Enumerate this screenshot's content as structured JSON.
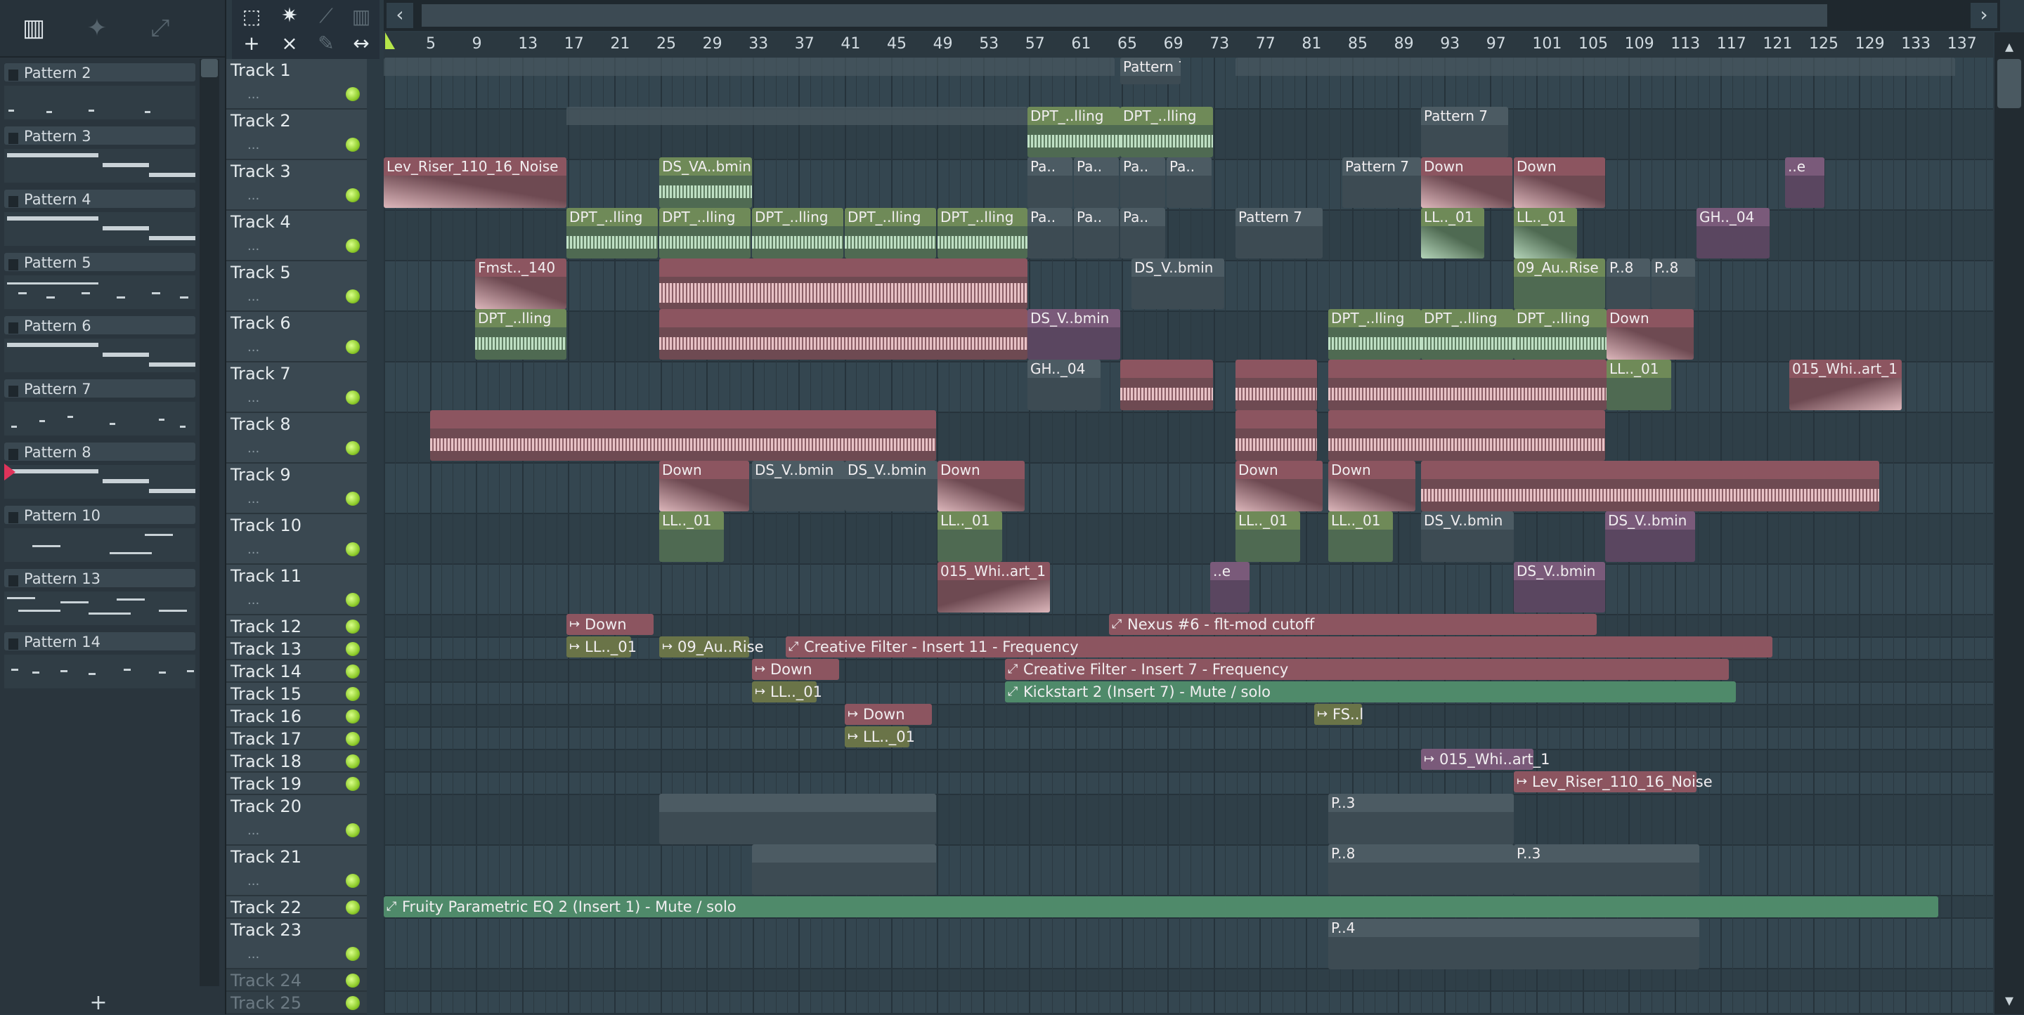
{
  "picker": {
    "patterns": [
      {
        "name": "Pattern 2"
      },
      {
        "name": "Pattern 3"
      },
      {
        "name": "Pattern 4"
      },
      {
        "name": "Pattern 5"
      },
      {
        "name": "Pattern 6"
      },
      {
        "name": "Pattern 7"
      },
      {
        "name": "Pattern 8"
      },
      {
        "name": "Pattern 10"
      },
      {
        "name": "Pattern 13"
      },
      {
        "name": "Pattern 14"
      }
    ],
    "add_label": "+"
  },
  "toolbar": {
    "add_label": "+",
    "close_label": "×"
  },
  "ruler": {
    "bars": [
      "5",
      "9",
      "13",
      "17",
      "21",
      "25",
      "29",
      "33",
      "37",
      "41",
      "45",
      "49",
      "53",
      "57",
      "61",
      "65",
      "69",
      "73",
      "77",
      "81",
      "85",
      "89",
      "93",
      "97",
      "101",
      "105",
      "109",
      "113",
      "117",
      "121",
      "125",
      "129",
      "133",
      "137"
    ]
  },
  "tracks": [
    {
      "name": "Track 1"
    },
    {
      "name": "Track 2"
    },
    {
      "name": "Track 3"
    },
    {
      "name": "Track 4"
    },
    {
      "name": "Track 5"
    },
    {
      "name": "Track 6"
    },
    {
      "name": "Track 7"
    },
    {
      "name": "Track 8"
    },
    {
      "name": "Track 9"
    },
    {
      "name": "Track 10"
    },
    {
      "name": "Track 11"
    },
    {
      "name": "Track 12"
    },
    {
      "name": "Track 13"
    },
    {
      "name": "Track 14"
    },
    {
      "name": "Track 15"
    },
    {
      "name": "Track 16"
    },
    {
      "name": "Track 17"
    },
    {
      "name": "Track 18"
    },
    {
      "name": "Track 19"
    },
    {
      "name": "Track 20"
    },
    {
      "name": "Track 21"
    },
    {
      "name": "Track 22"
    },
    {
      "name": "Track 23"
    },
    {
      "name": "Track 24"
    },
    {
      "name": "Track 25"
    }
  ],
  "track_dots": "...",
  "clips": {
    "t1_pattern7": "Pattern 7",
    "t2_dpt_a": "DPT_..lling",
    "t2_dpt_b": "DPT_..lling",
    "t2_pattern7": "Pattern 7",
    "t3_riser": "Lev_Riser_110_16_Noise",
    "t3_dsva": "DS_VA..bmin",
    "t3_pa1": "Pa..",
    "t3_pa2": "Pa..",
    "t3_pa3": "Pa..",
    "t3_pa4": "Pa..",
    "t3_pattern7": "Pattern 7",
    "t3_down1": "Down",
    "t3_down2": "Down",
    "t3_e": "..e",
    "t4_dpt1": "DPT_..lling",
    "t4_dpt2": "DPT_..lling",
    "t4_dpt3": "DPT_..lling",
    "t4_dpt4": "DPT_..lling",
    "t4_dpt5": "DPT_..lling",
    "t4_pa1": "Pa..",
    "t4_pa2": "Pa..",
    "t4_pa3": "Pa..",
    "t4_pattern7": "Pattern 7",
    "t4_ll1": "LL.._01",
    "t4_ll2": "LL.._01",
    "t4_gh": "GH.._04",
    "t5_fmst": "Fmst.._140",
    "t5_dsv": "DS_V..bmin",
    "t5_09au": "09_Au..Rise",
    "t5_p8a": "P..8",
    "t5_p8b": "P..8",
    "t6_dpt": "DPT_..lling",
    "t6_dsv": "DS_V..bmin",
    "t6_dpt2": "DPT_..lling",
    "t6_dpt3": "DPT_..lling",
    "t6_dpt4": "DPT_..lling",
    "t6_down": "Down",
    "t7_gh": "GH.._04",
    "t7_ll": "LL.._01",
    "t7_015": "015_Whi..art_1",
    "t9_down1": "Down",
    "t9_dsv1": "DS_V..bmin",
    "t9_dsv2": "DS_V..bmin",
    "t9_down2": "Down",
    "t9_down3": "Down",
    "t9_down4": "Down",
    "t10_ll1": "LL.._01",
    "t10_ll2": "LL.._01",
    "t10_ll3": "LL.._01",
    "t10_ll4": "LL.._01",
    "t10_dsv1": "DS_V..bmin",
    "t10_dsv2": "DS_V..bmin",
    "t11_015": "015_Whi..art_1",
    "t11_e": "..e",
    "t11_dsv": "DS_V..bmin",
    "t12_down": "Down",
    "t12_nexus": "Nexus #6 - flt-mod cutoff",
    "t13_ll": "LL.._01",
    "t13_09au": "09_Au..Rise",
    "t13_filter": "Creative Filter - Insert 11 - Frequency",
    "t14_down": "Down",
    "t14_filter": "Creative Filter - Insert 7 - Frequency",
    "t15_ll": "LL.._01",
    "t15_kick": "Kickstart 2 (Insert 7) - Mute / solo",
    "t16_down": "Down",
    "t16_fs": "FS..l",
    "t17_ll": "LL.._01",
    "t18_015": "015_Whi..art_1",
    "t19_riser": "Lev_Riser_110_16_Noise",
    "t20_p3": "P..3",
    "t21_p8": "P..8",
    "t21_p3": "P..3",
    "t22_eq": "Fruity Parametric EQ 2 (Insert 1) - Mute / solo",
    "t23_p4": "P..4"
  }
}
